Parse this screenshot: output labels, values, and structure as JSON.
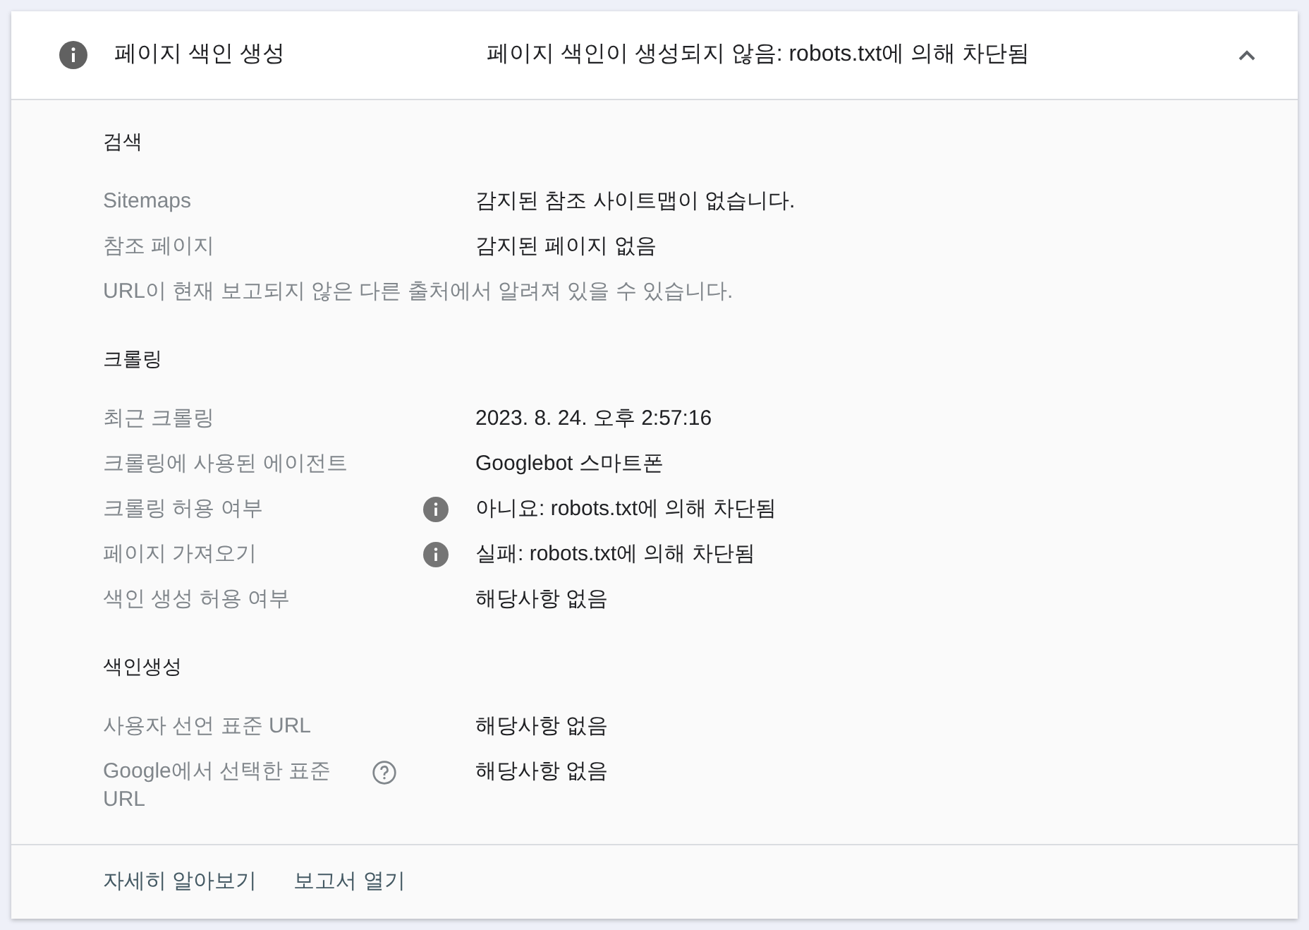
{
  "panel": {
    "title": "페이지 색인 생성",
    "status": "페이지 색인이 생성되지 않음: robots.txt에 의해 차단됨",
    "expanded": true
  },
  "sections": [
    {
      "heading": "검색",
      "rows": [
        {
          "kind": "plain",
          "label": "Sitemaps",
          "value": "감지된 참조 사이트맵이 없습니다."
        },
        {
          "kind": "plain",
          "label": "참조 페이지",
          "value": "감지된 페이지 없음"
        },
        {
          "kind": "note",
          "text": "URL이 현재 보고되지 않은 다른 출처에서 알려져 있을 수 있습니다."
        }
      ]
    },
    {
      "heading": "크롤링",
      "rows": [
        {
          "kind": "plain",
          "label": "최근 크롤링",
          "value": "2023. 8. 24. 오후 2:57:16"
        },
        {
          "kind": "plain",
          "label": "크롤링에 사용된 에이전트",
          "value": "Googlebot 스마트폰"
        },
        {
          "kind": "info",
          "label": "크롤링 허용 여부",
          "value": "아니요: robots.txt에 의해 차단됨"
        },
        {
          "kind": "info",
          "label": "페이지 가져오기",
          "value": "실패: robots.txt에 의해 차단됨"
        },
        {
          "kind": "plain",
          "label": "색인 생성 허용 여부",
          "value": "해당사항 없음"
        }
      ]
    },
    {
      "heading": "색인생성",
      "rows": [
        {
          "kind": "plain",
          "label": "사용자 선언 표준 URL",
          "value": "해당사항 없음"
        },
        {
          "kind": "help",
          "label": "Google에서 선택한 표준 URL",
          "value": "해당사항 없음"
        }
      ]
    }
  ],
  "footer": {
    "links": [
      "자세히 알아보기",
      "보고서 열기"
    ]
  }
}
